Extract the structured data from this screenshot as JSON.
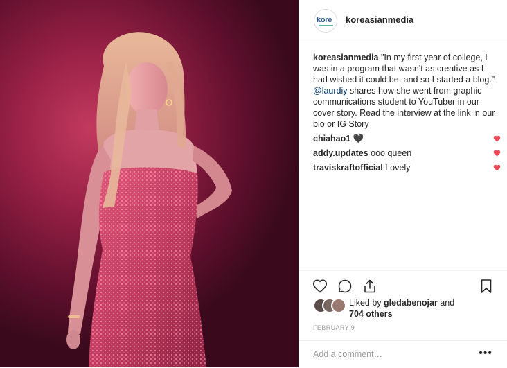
{
  "post": {
    "username": "koreasianmedia",
    "avatar_text": "kore",
    "caption_user": "koreasianmedia",
    "caption_part1": "\"In my first year of college, I was in a program that wasn't as creative as I had wished it could be, and so I started a blog.\" ",
    "caption_mention": "@laurdiy",
    "caption_part2": " shares how she went from graphic communications student to YouTuber in our cover story. Read the interview at the link in our bio or IG Story"
  },
  "comments": [
    {
      "user": "chiahao1",
      "text": "🖤"
    },
    {
      "user": "addy.updates",
      "text": "ooo queen"
    },
    {
      "user": "traviskraftofficial",
      "text": "Lovely"
    }
  ],
  "likes": {
    "prefix": "Liked by ",
    "user": "gledabenojar",
    "and": " and",
    "count": "704 others"
  },
  "date": "FEBRUARY 9",
  "add_comment_placeholder": "Add a comment…",
  "more_label": "•••",
  "colors": {
    "heart": "#ed4956",
    "mention": "#003569",
    "divider": "#efefef"
  },
  "icons": [
    "heart-icon",
    "comment-icon",
    "share-icon",
    "bookmark-icon",
    "more-options-icon"
  ]
}
